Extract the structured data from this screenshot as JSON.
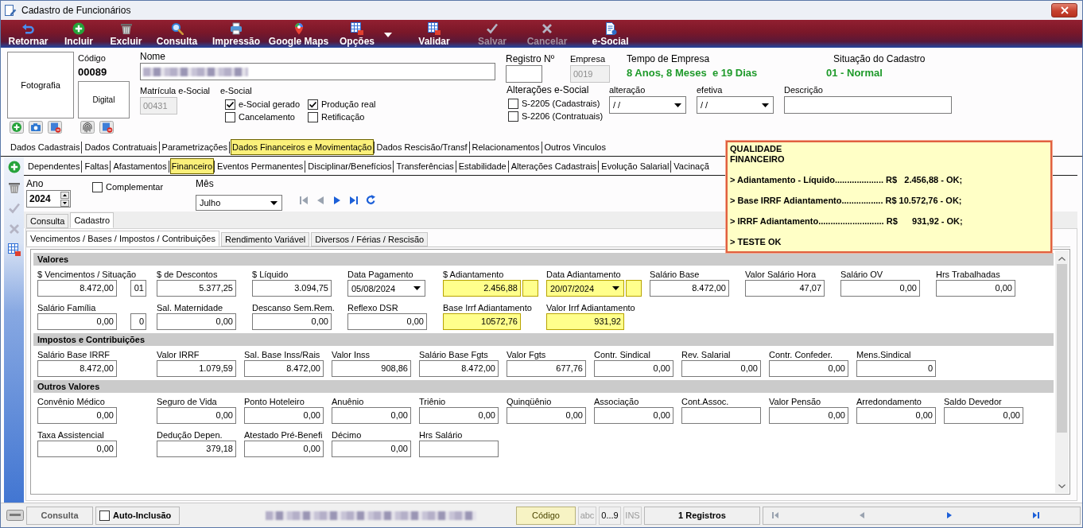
{
  "window": {
    "title": "Cadastro de Funcionários"
  },
  "toolbar": [
    {
      "label": "Retornar",
      "disabled": false,
      "dropdown": false
    },
    {
      "label": "Incluir",
      "disabled": false,
      "dropdown": false
    },
    {
      "label": "Excluir",
      "disabled": false,
      "dropdown": false
    },
    {
      "label": "Consulta",
      "disabled": false,
      "dropdown": false
    },
    {
      "label": "Impressão",
      "disabled": false,
      "dropdown": false
    },
    {
      "label": "Google Maps",
      "disabled": false,
      "dropdown": false
    },
    {
      "label": "Opções",
      "disabled": false,
      "dropdown": true
    },
    {
      "label": "Validar",
      "disabled": false,
      "dropdown": false
    },
    {
      "label": "Salvar",
      "disabled": true,
      "dropdown": false
    },
    {
      "label": "Cancelar",
      "disabled": true,
      "dropdown": false
    },
    {
      "label": "e-Social",
      "disabled": false,
      "dropdown": false
    }
  ],
  "header": {
    "photo": "Fotografia",
    "code_label": "Código",
    "code": "00089",
    "digital": "Digital",
    "name": {
      "label": "Nome",
      "redacted": true
    },
    "matricula": {
      "label": "Matrícula e-Social",
      "value": "00431",
      "disabled": true
    },
    "esocial": {
      "label": "e-Social",
      "options": [
        {
          "label": "e-Social gerado",
          "checked": true
        },
        {
          "label": "Produção real",
          "checked": true
        },
        {
          "label": "Cancelamento",
          "checked": false
        },
        {
          "label": "Retificação",
          "checked": false
        }
      ]
    },
    "registro": {
      "label": "Registro Nº"
    },
    "empresa": {
      "label": "Empresa",
      "value": "0019",
      "disabled": true
    },
    "tempo": {
      "label": "Tempo de Empresa",
      "value": "8 Anos, 8 Meses  e 19 Dias"
    },
    "situacao": {
      "label": "Situação do Cadastro",
      "value": "01 - Normal"
    },
    "alteracoes": {
      "label": "Alterações e-Social",
      "options": [
        {
          "label": "S-2205 (Cadastrais)",
          "checked": false
        },
        {
          "label": "S-2206 (Contratuais)",
          "checked": false
        }
      ]
    },
    "alteracao": {
      "label": "alteração",
      "value": "/ /"
    },
    "efetiva": {
      "label": "efetiva",
      "value": "/ /"
    },
    "descricao": {
      "label": "Descrição"
    }
  },
  "tabs": [
    {
      "label": "Dados Cadastrais",
      "selected": false
    },
    {
      "label": "Dados Contratuais",
      "selected": false
    },
    {
      "label": "Parametrizações",
      "selected": false
    },
    {
      "label": "Dados Financeiros e Movimentação",
      "selected": true
    },
    {
      "label": "Dados Rescisão/Transf",
      "selected": false
    },
    {
      "label": "Relacionamentos",
      "selected": false
    },
    {
      "label": "Outros Vinculos",
      "selected": false
    }
  ],
  "subtabs": [
    {
      "label": "Dependentes",
      "selected": false
    },
    {
      "label": "Faltas",
      "selected": false
    },
    {
      "label": "Afastamentos",
      "selected": false
    },
    {
      "label": "Financeiro",
      "selected": true
    },
    {
      "label": "Eventos Permanentes",
      "selected": false
    },
    {
      "label": "Disciplinar/Benefícios",
      "selected": false
    },
    {
      "label": "Transferências",
      "selected": false
    },
    {
      "label": "Estabilidade",
      "selected": false
    },
    {
      "label": "Alterações Cadastrais",
      "selected": false
    },
    {
      "label": "Evolução Salarial",
      "selected": false
    },
    {
      "label": "Vacinaçã",
      "selected": false
    }
  ],
  "period": {
    "year_label": "Ano",
    "year": "2024",
    "complementar": {
      "label": "Complementar",
      "checked": false
    },
    "month_label": "Mês",
    "month": "Julho"
  },
  "view_tabs": [
    {
      "label": "Consulta",
      "selected": false
    },
    {
      "label": "Cadastro",
      "selected": true
    }
  ],
  "page_tabs": [
    {
      "label": "Vencimentos / Bases / Impostos / Contribuições",
      "selected": true
    },
    {
      "label": "Rendimento Variável",
      "selected": false
    },
    {
      "label": "Diversos / Férias / Rescisão",
      "selected": false
    }
  ],
  "sections": [
    {
      "title": "Valores",
      "rows": [
        [
          {
            "label": "$ Vencimentos / Situação",
            "kind": "amount_code",
            "value": "8.472,00",
            "box_value": "01",
            "highlighted": false
          },
          {
            "label": "$ de Descontos",
            "kind": "amount",
            "value": "5.377,25",
            "highlighted": false
          },
          {
            "label": "$ Líquido",
            "kind": "amount",
            "value": "3.094,75",
            "highlighted": false
          },
          {
            "label": "Data Pagamento",
            "kind": "date",
            "value": "05/08/2024",
            "highlighted": false
          },
          {
            "label": "$ Adiantamento",
            "kind": "amount_box",
            "value": "2.456,88",
            "highlighted": true
          },
          {
            "label": "Data Adiantamento",
            "kind": "date_box",
            "value": "20/07/2024",
            "highlighted": true
          },
          {
            "label": "Salário Base",
            "kind": "amount",
            "value": "8.472,00",
            "highlighted": false
          },
          {
            "label": "Valor Salário Hora",
            "kind": "amount",
            "value": "47,07",
            "highlighted": false
          },
          {
            "label": "Salário OV",
            "kind": "amount",
            "value": "0,00",
            "highlighted": false
          },
          {
            "label": "Hrs Trabalhadas",
            "kind": "amount",
            "value": "0,00",
            "highlighted": false
          }
        ],
        [
          {
            "label": "Salário Família",
            "kind": "amount_code",
            "value": "0,00",
            "box_value": "0",
            "highlighted": false
          },
          {
            "label": "Sal. Maternidade",
            "kind": "amount",
            "value": "0,00",
            "highlighted": false
          },
          {
            "label": "Descanso Sem.Rem.",
            "kind": "amount",
            "value": "0,00",
            "highlighted": false
          },
          {
            "label": "Reflexo DSR",
            "kind": "amount",
            "value": "0,00",
            "highlighted": false
          },
          {
            "label": "Base Irrf Adiantamento",
            "kind": "amount",
            "value": "10572,76",
            "highlighted": true
          },
          {
            "label": "Valor Irrf Adiantamento",
            "kind": "amount",
            "value": "931,92",
            "highlighted": true
          }
        ]
      ]
    },
    {
      "title": "Impostos e Contribuições",
      "rows": [
        [
          {
            "label": "Salário Base IRRF",
            "kind": "amount",
            "value": "8.472,00",
            "highlighted": false
          },
          {
            "label": "Valor IRRF",
            "kind": "amount",
            "value": "1.079,59",
            "highlighted": false
          },
          {
            "label": "Sal. Base Inss/Rais",
            "kind": "amount",
            "value": "8.472,00",
            "highlighted": false
          },
          {
            "label": "Valor Inss",
            "kind": "amount",
            "value": "908,86",
            "highlighted": false
          },
          {
            "label": "Salário Base Fgts",
            "kind": "amount",
            "value": "8.472,00",
            "highlighted": false
          },
          {
            "label": "Valor Fgts",
            "kind": "amount",
            "value": "677,76",
            "highlighted": false
          },
          {
            "label": "Contr. Sindical",
            "kind": "amount",
            "value": "0,00",
            "highlighted": false
          },
          {
            "label": "Rev. Salarial",
            "kind": "amount",
            "value": "0,00",
            "highlighted": false
          },
          {
            "label": "Contr. Confeder.",
            "kind": "amount",
            "value": "0,00",
            "highlighted": false
          },
          {
            "label": "Mens.Sindical",
            "kind": "amount",
            "value": "0",
            "highlighted": false
          }
        ]
      ]
    },
    {
      "title": "Outros Valores",
      "rows": [
        [
          {
            "label": "Convênio Médico",
            "kind": "amount",
            "value": "0,00",
            "highlighted": false
          },
          {
            "label": "Seguro de Vida",
            "kind": "amount",
            "value": "0,00",
            "highlighted": false
          },
          {
            "label": "Ponto Hoteleiro",
            "kind": "amount",
            "value": "0,00",
            "highlighted": false
          },
          {
            "label": "Anuênio",
            "kind": "amount",
            "value": "0,00",
            "highlighted": false
          },
          {
            "label": "Triênio",
            "kind": "amount",
            "value": "0,00",
            "highlighted": false
          },
          {
            "label": "Quinqüênio",
            "kind": "amount",
            "value": "0,00",
            "highlighted": false
          },
          {
            "label": "Associação",
            "kind": "amount",
            "value": "0,00",
            "highlighted": false
          },
          {
            "label": "Cont.Assoc.",
            "kind": "amount",
            "highlighted": false
          },
          {
            "label": "Valor Pensão",
            "kind": "amount",
            "value": "0,00",
            "highlighted": false
          },
          {
            "label": "Arredondamento",
            "kind": "amount",
            "value": "0,00",
            "highlighted": false
          },
          {
            "label": "Saldo Devedor",
            "kind": "amount",
            "value": "0,00",
            "highlighted": false
          }
        ],
        [
          {
            "label": "Taxa Assistencial",
            "kind": "amount",
            "value": "0,00",
            "highlighted": false
          },
          {
            "label": "Dedução Depen.",
            "kind": "amount",
            "value": "379,18",
            "highlighted": false
          },
          {
            "label": "Atestado Pré-Benefi",
            "kind": "amount",
            "value": "0,00",
            "highlighted": false
          },
          {
            "label": "Décimo",
            "kind": "amount",
            "value": "0,00",
            "highlighted": false
          },
          {
            "label": "Hrs Salário",
            "kind": "amount",
            "highlighted": false
          }
        ]
      ]
    }
  ],
  "tooltip": {
    "title": [
      "QUALIDADE",
      "FINANCEIRO"
    ],
    "lines": [
      "> Adiantamento - Líquido.................... R$   2.456,88 - OK;",
      "> Base IRRF Adiantamento................. R$ 10.572,76 - OK;",
      "> IRRF Adiantamento........................... R$      931,92 - OK;",
      "> TESTE OK"
    ]
  },
  "status_bar": {
    "mode": "Consulta",
    "auto_inclusao": {
      "label": "Auto-Inclusão",
      "checked": false
    },
    "redacted": true,
    "search_field": "Código",
    "indicators": [
      {
        "label": "abc",
        "active": false
      },
      {
        "label": "0...9",
        "active": true
      },
      {
        "label": "INS",
        "active": false
      }
    ],
    "records": "1 Registros"
  }
}
